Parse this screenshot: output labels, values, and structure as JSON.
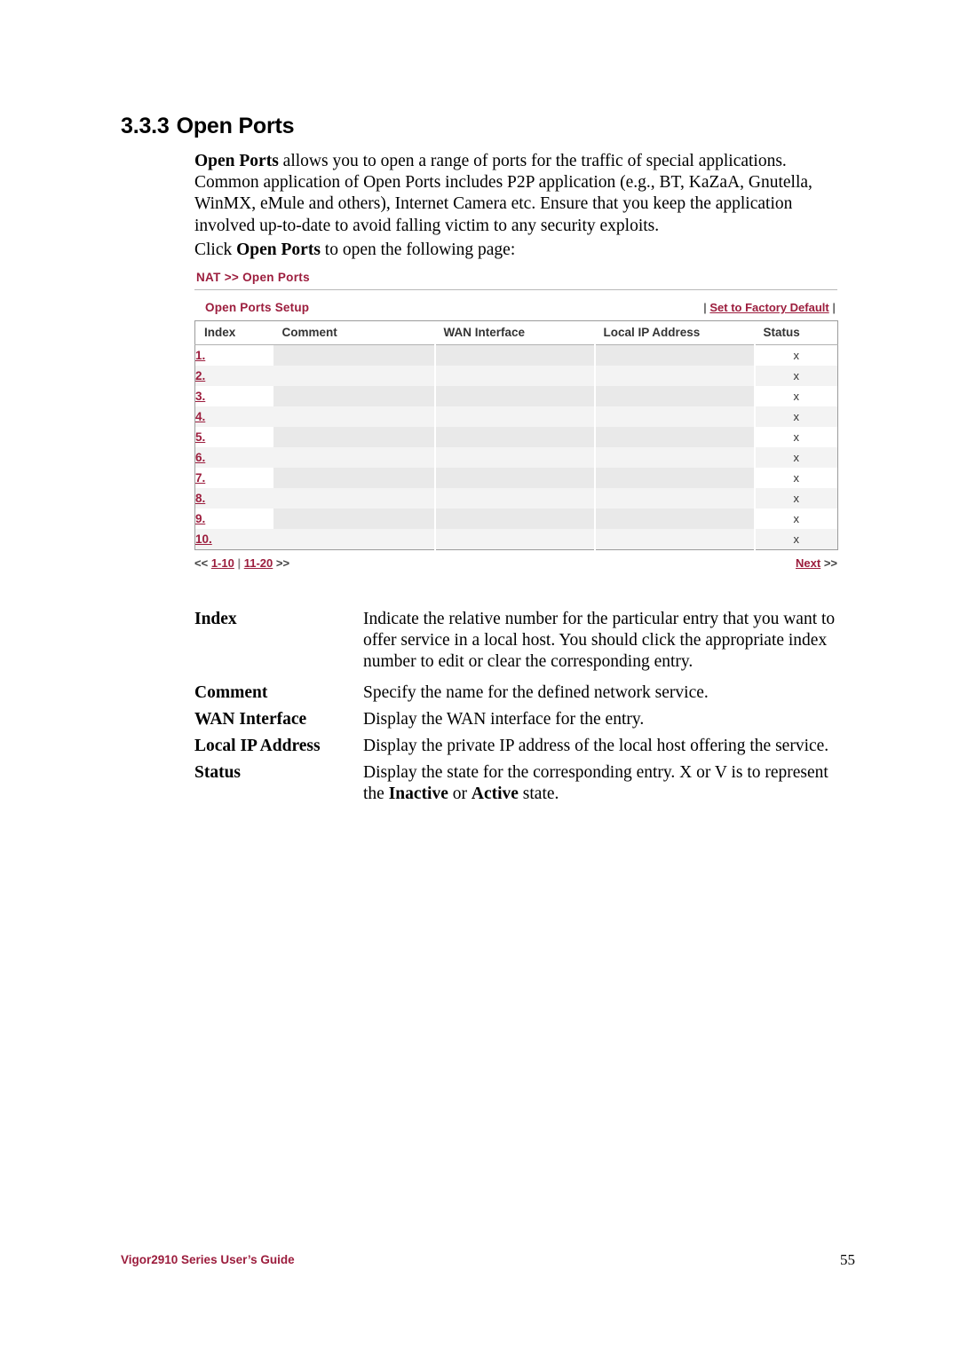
{
  "heading": {
    "number": "3.3.3",
    "title": "Open Ports"
  },
  "intro": {
    "bold_lead": "Open Ports",
    "body": " allows you to open a range of ports for the traffic of special applications. Common application of Open Ports includes P2P application (e.g., BT, KaZaA, Gnutella, WinMX, eMule and others), Internet Camera etc. Ensure that you keep the application involved up-to-date to avoid falling victim to any security exploits.",
    "click_prefix": "Click ",
    "click_bold": "Open Ports",
    "click_suffix": " to open the following page:"
  },
  "screenshot": {
    "breadcrumb": "NAT >> Open Ports",
    "panel_title": "Open Ports Setup",
    "set_factory_default": "Set to Factory Default",
    "bar": "|",
    "columns": [
      "Index",
      "Comment",
      "WAN Interface",
      "Local IP Address",
      "Status"
    ],
    "rows": [
      {
        "index": "1.",
        "comment": "",
        "wan": "",
        "lip": "",
        "status": "x"
      },
      {
        "index": "2.",
        "comment": "",
        "wan": "",
        "lip": "",
        "status": "x"
      },
      {
        "index": "3.",
        "comment": "",
        "wan": "",
        "lip": "",
        "status": "x"
      },
      {
        "index": "4.",
        "comment": "",
        "wan": "",
        "lip": "",
        "status": "x"
      },
      {
        "index": "5.",
        "comment": "",
        "wan": "",
        "lip": "",
        "status": "x"
      },
      {
        "index": "6.",
        "comment": "",
        "wan": "",
        "lip": "",
        "status": "x"
      },
      {
        "index": "7.",
        "comment": "",
        "wan": "",
        "lip": "",
        "status": "x"
      },
      {
        "index": "8.",
        "comment": "",
        "wan": "",
        "lip": "",
        "status": "x"
      },
      {
        "index": "9.",
        "comment": "",
        "wan": "",
        "lip": "",
        "status": "x"
      },
      {
        "index": "10.",
        "comment": "",
        "wan": "",
        "lip": "",
        "status": "x"
      }
    ],
    "pager": {
      "prev_marks": "<<",
      "page_1": "1-10",
      "sep": "|",
      "page_2": "11-20",
      "next_marks": ">>",
      "next_label": "Next",
      "next_arrows": ">>"
    }
  },
  "definitions": [
    {
      "term": "Index",
      "desc": "Indicate the relative number for the particular entry that you want to offer service in a local host. You should click the appropriate index number to edit or clear the corresponding entry."
    },
    {
      "term": "Comment",
      "desc": "Specify the name for the defined network service."
    },
    {
      "term": "WAN Interface",
      "desc": "Display the WAN interface for the entry."
    },
    {
      "term": "Local IP Address",
      "desc": "Display the private IP address of the local host offering the service."
    },
    {
      "term": "Status",
      "desc_part1": "Display the state for the corresponding entry. X or V is to represent the ",
      "desc_bold1": "Inactive",
      "desc_mid": " or ",
      "desc_bold2": "Active",
      "desc_part2": " state."
    }
  ],
  "footer": {
    "left": "Vigor2910 Series User’s Guide",
    "page": "55"
  }
}
